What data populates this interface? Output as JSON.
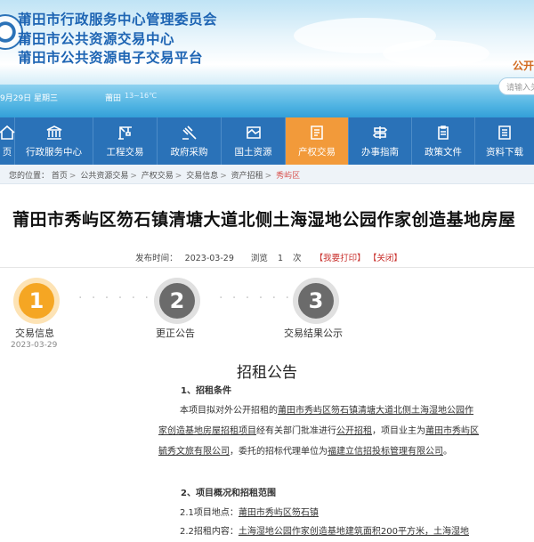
{
  "header": {
    "org_line1": "莆田市行政服务中心管理委员会",
    "org_line2": "莆田市公共资源交易中心",
    "org_line3": "莆田市公共资源电子交易平台",
    "slogan": "公开",
    "date": "9月29日 星期三",
    "weather_city": "莆田",
    "weather_temp": "13~16℃",
    "search_placeholder": "请输入关"
  },
  "nav": {
    "items": [
      {
        "label": "页",
        "icon": "home-icon"
      },
      {
        "label": "行政服务中心",
        "icon": "building-icon"
      },
      {
        "label": "工程交易",
        "icon": "crane-icon"
      },
      {
        "label": "政府采购",
        "icon": "gavel-icon"
      },
      {
        "label": "国土资源",
        "icon": "land-icon"
      },
      {
        "label": "产权交易",
        "icon": "document-icon",
        "active": true
      },
      {
        "label": "办事指南",
        "icon": "signpost-icon"
      },
      {
        "label": "政策文件",
        "icon": "clipboard-icon"
      },
      {
        "label": "资料下载",
        "icon": "download-icon"
      }
    ],
    "bg_color": "#2a72b8",
    "active_color": "#f29a3a"
  },
  "breadcrumb": {
    "prefix": "您的位置：",
    "items": [
      "首页",
      "公共资源交易",
      "产权交易",
      "交易信息",
      "资产招租",
      "秀屿区"
    ]
  },
  "article": {
    "title": "莆田市秀屿区笏石镇清塘大道北侧土海湿地公园作家创造基地房屋",
    "published_label": "发布时间：",
    "published": "2023-03-29",
    "views_label": "浏览",
    "views": "1",
    "views_unit": "次",
    "print_link": "【我要打印】",
    "close_link": "【关闭】"
  },
  "steps": [
    {
      "number": "1",
      "label": "交易信息",
      "date": "2023-03-29",
      "active": true
    },
    {
      "number": "2",
      "label": "更正公告",
      "date": "",
      "active": false
    },
    {
      "number": "3",
      "label": "交易结果公示",
      "date": "",
      "active": false
    }
  ],
  "content": {
    "doc_title": "招租公告",
    "section1_title": "1、招租条件",
    "section1_body": [
      {
        "text": "本项目拟对外公开招租的",
        "u": false
      },
      {
        "text": "莆田市秀屿区笏石镇清塘大道北侧土海湿地公园作家创造基地房屋招租项目",
        "u": true
      },
      {
        "text": "经有关部门批准进行",
        "u": false
      },
      {
        "text": "公开招租",
        "u": true
      },
      {
        "text": "，项目业主为",
        "u": false
      },
      {
        "text": "莆田市秀屿区毓秀文旅有限公司",
        "u": true
      },
      {
        "text": "，委托的招标代理单位为",
        "u": false
      },
      {
        "text": "福建立信招投标管理有限公司",
        "u": true
      },
      {
        "text": "。",
        "u": false
      }
    ],
    "section2_title": "2、项目概况和招租范围",
    "item21_label": "2.1项目地点：",
    "item21_value": "莆田市秀屿区笏石镇",
    "item22_label": "2.2招租内容：",
    "item22_value": "土海湿地公园作家创造基地建筑面积200平方米，土海湿地"
  }
}
